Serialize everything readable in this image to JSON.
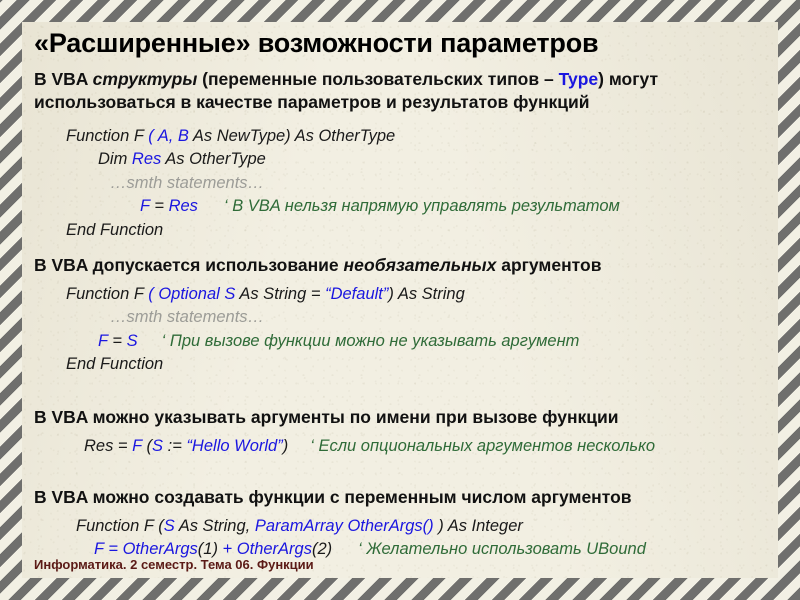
{
  "slide": {
    "title": "«Расширенные» возможности параметров",
    "footer": "Информатика. 2 семестр. Тема 06. Функции"
  },
  "colors": {
    "paper": "#f2efe2",
    "border_stripe_dark": "#6f6f6d",
    "border_stripe_light": "#f2f0e4",
    "keyword_blue": "#1a16e0",
    "comment_green": "#2f6b38",
    "placeholder_gray": "#9c9c97",
    "footer_maroon": "#5b1a16",
    "text_black": "#111111"
  },
  "intro": {
    "part1": "В VBA ",
    "emph": "структуры",
    "part2": " (переменные пользовательских типов – ",
    "keyword": "Type",
    "part3": ") могут использоваться в качестве параметров и результатов функций"
  },
  "block1": {
    "l1_a": "Function  F ",
    "l1_b": "( ",
    "l1_c": "A, B",
    "l1_d": "  As NewType) As OtherType",
    "l2_a": "Dim  ",
    "l2_b": "Res",
    "l2_c": "  As  OtherType",
    "l3": "…smth statements…",
    "l4_a": "F",
    "l4_b": " = ",
    "l4_c": "Res",
    "l4_d": "‘ В VBA нельзя напрямую управлять результатом",
    "l5": "End Function"
  },
  "head2": {
    "a": "В VBA допускается использование ",
    "emph": "необязательных",
    "b": " аргументов"
  },
  "block2": {
    "l1_a": "Function  F ",
    "l1_b": "( ",
    "l1_c": "Optional  S",
    "l1_d": "  As String = ",
    "l1_e": "“Default”",
    "l1_f": ") As String",
    "l2": "…smth statements…",
    "l3_a": "F",
    "l3_b": " = ",
    "l3_c": "S",
    "l3_d": "‘ При вызове функции можно не указывать аргумент",
    "l4": "End Function"
  },
  "head3": {
    "a": "В VBA можно указывать аргументы по имени при вызове функции"
  },
  "block3": {
    "l1_a": "Res = ",
    "l1_b": "F",
    "l1_c": " (",
    "l1_d": "S",
    "l1_e": " := ",
    "l1_f": "“Hello World”",
    "l1_g": ")",
    "l1_h": "‘ Если опциональных аргументов несколько"
  },
  "head4": {
    "a": "В VBA можно создавать функции с переменным числом аргументов"
  },
  "block4": {
    "l1_a": "Function  F (",
    "l1_b": "S",
    "l1_c": "  As String, ",
    "l1_d": "ParamArray OtherArgs",
    "l1_e": "()",
    "l1_f": " ) As Integer",
    "l2_a": "F",
    "l2_b": " = ",
    "l2_c": "OtherArgs",
    "l2_d": "(1)",
    "l2_e": " + ",
    "l2_f": "OtherArgs",
    "l2_g": "(2)",
    "l2_h": "‘ Желательно использовать UBound"
  }
}
